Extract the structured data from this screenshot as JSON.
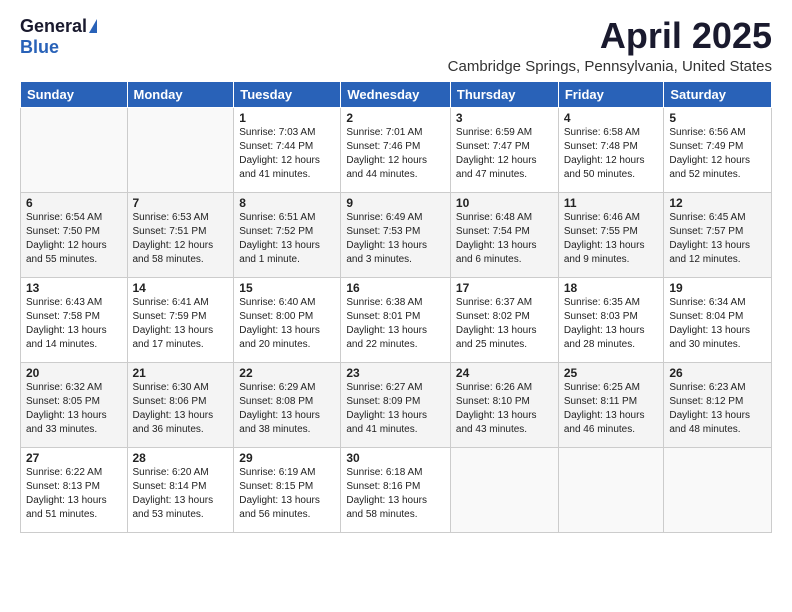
{
  "logo": {
    "general": "General",
    "blue": "Blue"
  },
  "title": "April 2025",
  "location": "Cambridge Springs, Pennsylvania, United States",
  "days_of_week": [
    "Sunday",
    "Monday",
    "Tuesday",
    "Wednesday",
    "Thursday",
    "Friday",
    "Saturday"
  ],
  "weeks": [
    [
      {
        "day": "",
        "info": ""
      },
      {
        "day": "",
        "info": ""
      },
      {
        "day": "1",
        "info": "Sunrise: 7:03 AM\nSunset: 7:44 PM\nDaylight: 12 hours and 41 minutes."
      },
      {
        "day": "2",
        "info": "Sunrise: 7:01 AM\nSunset: 7:46 PM\nDaylight: 12 hours and 44 minutes."
      },
      {
        "day": "3",
        "info": "Sunrise: 6:59 AM\nSunset: 7:47 PM\nDaylight: 12 hours and 47 minutes."
      },
      {
        "day": "4",
        "info": "Sunrise: 6:58 AM\nSunset: 7:48 PM\nDaylight: 12 hours and 50 minutes."
      },
      {
        "day": "5",
        "info": "Sunrise: 6:56 AM\nSunset: 7:49 PM\nDaylight: 12 hours and 52 minutes."
      }
    ],
    [
      {
        "day": "6",
        "info": "Sunrise: 6:54 AM\nSunset: 7:50 PM\nDaylight: 12 hours and 55 minutes."
      },
      {
        "day": "7",
        "info": "Sunrise: 6:53 AM\nSunset: 7:51 PM\nDaylight: 12 hours and 58 minutes."
      },
      {
        "day": "8",
        "info": "Sunrise: 6:51 AM\nSunset: 7:52 PM\nDaylight: 13 hours and 1 minute."
      },
      {
        "day": "9",
        "info": "Sunrise: 6:49 AM\nSunset: 7:53 PM\nDaylight: 13 hours and 3 minutes."
      },
      {
        "day": "10",
        "info": "Sunrise: 6:48 AM\nSunset: 7:54 PM\nDaylight: 13 hours and 6 minutes."
      },
      {
        "day": "11",
        "info": "Sunrise: 6:46 AM\nSunset: 7:55 PM\nDaylight: 13 hours and 9 minutes."
      },
      {
        "day": "12",
        "info": "Sunrise: 6:45 AM\nSunset: 7:57 PM\nDaylight: 13 hours and 12 minutes."
      }
    ],
    [
      {
        "day": "13",
        "info": "Sunrise: 6:43 AM\nSunset: 7:58 PM\nDaylight: 13 hours and 14 minutes."
      },
      {
        "day": "14",
        "info": "Sunrise: 6:41 AM\nSunset: 7:59 PM\nDaylight: 13 hours and 17 minutes."
      },
      {
        "day": "15",
        "info": "Sunrise: 6:40 AM\nSunset: 8:00 PM\nDaylight: 13 hours and 20 minutes."
      },
      {
        "day": "16",
        "info": "Sunrise: 6:38 AM\nSunset: 8:01 PM\nDaylight: 13 hours and 22 minutes."
      },
      {
        "day": "17",
        "info": "Sunrise: 6:37 AM\nSunset: 8:02 PM\nDaylight: 13 hours and 25 minutes."
      },
      {
        "day": "18",
        "info": "Sunrise: 6:35 AM\nSunset: 8:03 PM\nDaylight: 13 hours and 28 minutes."
      },
      {
        "day": "19",
        "info": "Sunrise: 6:34 AM\nSunset: 8:04 PM\nDaylight: 13 hours and 30 minutes."
      }
    ],
    [
      {
        "day": "20",
        "info": "Sunrise: 6:32 AM\nSunset: 8:05 PM\nDaylight: 13 hours and 33 minutes."
      },
      {
        "day": "21",
        "info": "Sunrise: 6:30 AM\nSunset: 8:06 PM\nDaylight: 13 hours and 36 minutes."
      },
      {
        "day": "22",
        "info": "Sunrise: 6:29 AM\nSunset: 8:08 PM\nDaylight: 13 hours and 38 minutes."
      },
      {
        "day": "23",
        "info": "Sunrise: 6:27 AM\nSunset: 8:09 PM\nDaylight: 13 hours and 41 minutes."
      },
      {
        "day": "24",
        "info": "Sunrise: 6:26 AM\nSunset: 8:10 PM\nDaylight: 13 hours and 43 minutes."
      },
      {
        "day": "25",
        "info": "Sunrise: 6:25 AM\nSunset: 8:11 PM\nDaylight: 13 hours and 46 minutes."
      },
      {
        "day": "26",
        "info": "Sunrise: 6:23 AM\nSunset: 8:12 PM\nDaylight: 13 hours and 48 minutes."
      }
    ],
    [
      {
        "day": "27",
        "info": "Sunrise: 6:22 AM\nSunset: 8:13 PM\nDaylight: 13 hours and 51 minutes."
      },
      {
        "day": "28",
        "info": "Sunrise: 6:20 AM\nSunset: 8:14 PM\nDaylight: 13 hours and 53 minutes."
      },
      {
        "day": "29",
        "info": "Sunrise: 6:19 AM\nSunset: 8:15 PM\nDaylight: 13 hours and 56 minutes."
      },
      {
        "day": "30",
        "info": "Sunrise: 6:18 AM\nSunset: 8:16 PM\nDaylight: 13 hours and 58 minutes."
      },
      {
        "day": "",
        "info": ""
      },
      {
        "day": "",
        "info": ""
      },
      {
        "day": "",
        "info": ""
      }
    ]
  ]
}
